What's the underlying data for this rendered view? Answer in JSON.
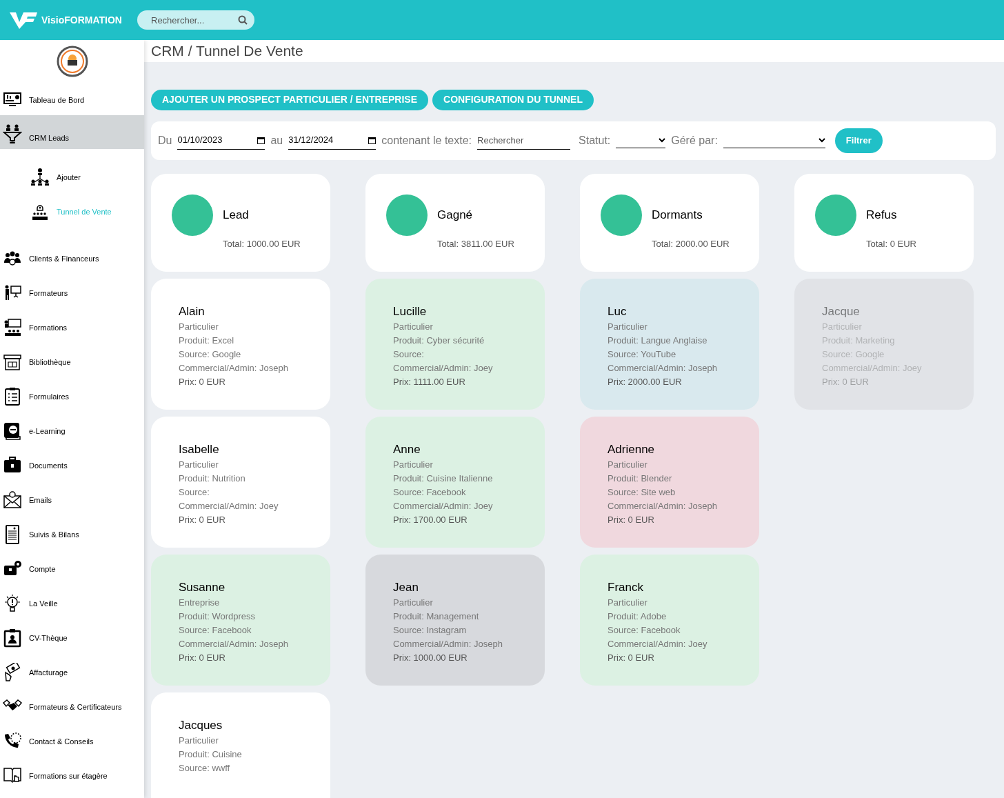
{
  "topbar": {
    "brand": "VisioFORMATION",
    "search": {
      "placeholder": "Rechercher..."
    }
  },
  "sidebar": {
    "items": [
      {
        "label": "Tableau de Bord",
        "selected": false
      },
      {
        "label": "CRM Leads",
        "selected": true,
        "expanded": true,
        "children": [
          {
            "label": "Ajouter",
            "selected": false
          },
          {
            "label": "Tunnel de Vente",
            "selected": true
          }
        ]
      },
      {
        "label": "Clients & Financeurs",
        "selected": false
      },
      {
        "label": "Formateurs",
        "selected": false
      },
      {
        "label": "Formations",
        "selected": false
      },
      {
        "label": "Bibliothèque",
        "selected": false
      },
      {
        "label": "Formulaires",
        "selected": false
      },
      {
        "label": "e-Learning",
        "selected": false
      },
      {
        "label": "Documents",
        "selected": false
      },
      {
        "label": "Emails",
        "selected": false
      },
      {
        "label": "Suivis & Bilans",
        "selected": false
      },
      {
        "label": "Compte",
        "selected": false
      },
      {
        "label": "La Veille",
        "selected": false
      },
      {
        "label": "CV-Thèque",
        "selected": false
      },
      {
        "label": "Affacturage",
        "selected": false
      },
      {
        "label": "Formateurs & Certificateurs",
        "selected": false
      },
      {
        "label": "Contact & Conseils",
        "selected": false
      },
      {
        "label": "Formations sur étagère",
        "selected": false
      }
    ]
  },
  "breadcrumb": "CRM / Tunnel De Vente",
  "actions": [
    "AJOUTER UN PROSPECT PARTICULIER / ENTREPRISE",
    "CONFIGURATION DU TUNNEL"
  ],
  "filters": {
    "from_label": "Du",
    "from_value": "01/10/2023",
    "to_label": "au",
    "to_value": "31/12/2024",
    "text_label": "contenant le texte:",
    "text_placeholder": "Rechercher",
    "status_label": "Statut:",
    "manager_label": "Géré par:",
    "button": "Filtrer"
  },
  "columns": [
    {
      "title": "Lead",
      "total": "Total: 1000.00 EUR",
      "color": "#34c196",
      "cards": [
        {
          "name": "Alain",
          "type": "Particulier",
          "product": "Produit: Excel",
          "source": "Source: Google",
          "manager": "Commercial/Admin: Joseph",
          "price": "Prix: 0 EUR",
          "color": "#ffffff",
          "dimmed": false
        },
        {
          "name": "Isabelle",
          "type": "Particulier",
          "product": "Produit: Nutrition",
          "source": "Source:",
          "manager": "Commercial/Admin: Joey",
          "price": "Prix: 0 EUR",
          "color": "#ffffff",
          "dimmed": false
        },
        {
          "name": "Susanne",
          "type": "Entreprise",
          "product": "Produit: Wordpress",
          "source": "Source: Facebook",
          "manager": "Commercial/Admin: Joseph",
          "price": "Prix: 0 EUR",
          "color": "#dcf1e3",
          "dimmed": false
        },
        {
          "name": "Jacques",
          "type": "Particulier",
          "product": "Produit: Cuisine",
          "source": "Source: wwff",
          "color": "#ffffff",
          "dimmed": false
        }
      ]
    },
    {
      "title": "Gagné",
      "total": "Total: 3811.00 EUR",
      "color": "#34c196",
      "cards": [
        {
          "name": "Lucille",
          "type": "Particulier",
          "product": "Produit: Cyber sécurité",
          "source": "Source:",
          "manager": "Commercial/Admin: Joey",
          "price": "Prix: 1111.00 EUR",
          "color": "#dcf1e3",
          "dimmed": false
        },
        {
          "name": "Anne",
          "type": "Particulier",
          "product": "Produit: Cuisine Italienne",
          "source": "Source: Facebook",
          "manager": "Commercial/Admin: Joey",
          "price": "Prix: 1700.00 EUR",
          "color": "#dcf1e3",
          "dimmed": false
        },
        {
          "name": "Jean",
          "type": "Particulier",
          "product": "Produit: Management",
          "source": "Source: Instagram",
          "manager": "Commercial/Admin: Joseph",
          "price": "Prix: 1000.00 EUR",
          "color": "#d7d9dd",
          "dimmed": false
        }
      ]
    },
    {
      "title": "Dormants",
      "total": "Total: 2000.00 EUR",
      "color": "#34c196",
      "cards": [
        {
          "name": "Luc",
          "type": "Particulier",
          "product": "Produit: Langue Anglaise",
          "source": "Source: YouTube",
          "manager": "Commercial/Admin: Joseph",
          "price": "Prix: 2000.00 EUR",
          "color": "#d9e9ee",
          "dimmed": false
        },
        {
          "name": "Adrienne",
          "type": "Particulier",
          "product": "Produit: Blender",
          "source": "Source: Site web",
          "manager": "Commercial/Admin: Joseph",
          "price": "Prix: 0 EUR",
          "color": "#f0d8de",
          "dimmed": false
        },
        {
          "name": "Franck",
          "type": "Particulier",
          "product": "Produit: Adobe",
          "source": "Source: Facebook",
          "manager": "Commercial/Admin: Joey",
          "price": "Prix: 0 EUR",
          "color": "#dcf1e3",
          "dimmed": false
        }
      ]
    },
    {
      "title": "Refus",
      "total": "Total: 0 EUR",
      "color": "#34c196",
      "cards": [
        {
          "name": "Jacque",
          "type": "Particulier",
          "product": "Produit: Marketing",
          "source": "Source: Google",
          "manager": "Commercial/Admin: Joey",
          "price": "Prix: 0 EUR",
          "color": "#d7d9dd",
          "dimmed": true
        }
      ]
    }
  ]
}
